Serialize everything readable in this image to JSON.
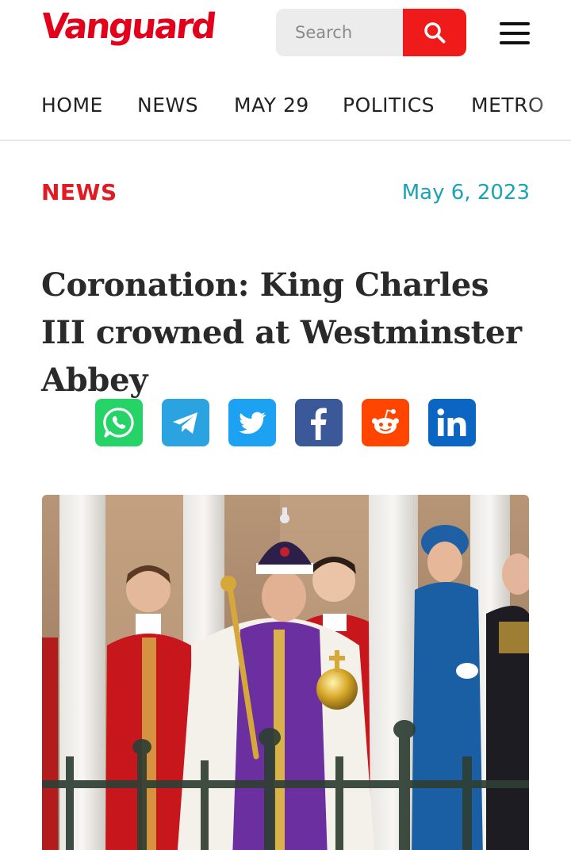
{
  "header": {
    "logo_text": "Vanguard",
    "search_placeholder": "Search",
    "search_icon": "search-icon",
    "menu_icon": "hamburger-menu-icon"
  },
  "nav": {
    "items": [
      {
        "label": "HOME"
      },
      {
        "label": "NEWS"
      },
      {
        "label": "MAY 29"
      },
      {
        "label": "POLITICS"
      },
      {
        "label": "METRO"
      }
    ]
  },
  "article": {
    "category": "NEWS",
    "date": "May 6, 2023",
    "title": "Coronation: King Charles III crowned at Westminster Abbey"
  },
  "share": {
    "buttons": [
      {
        "icon": "whatsapp-icon",
        "color": "#25d366"
      },
      {
        "icon": "telegram-icon",
        "color": "#2aa3e0"
      },
      {
        "icon": "twitter-icon",
        "color": "#1da1f2"
      },
      {
        "icon": "facebook-icon",
        "color": "#3b5998"
      },
      {
        "icon": "reddit-icon",
        "color": "#ff4500"
      },
      {
        "icon": "linkedin-icon",
        "color": "#0a66c2"
      }
    ]
  },
  "colors": {
    "brand": "#e2001a",
    "search_button": "#ef1b1b",
    "category": "#e01b22",
    "date": "#1aa3b5"
  }
}
